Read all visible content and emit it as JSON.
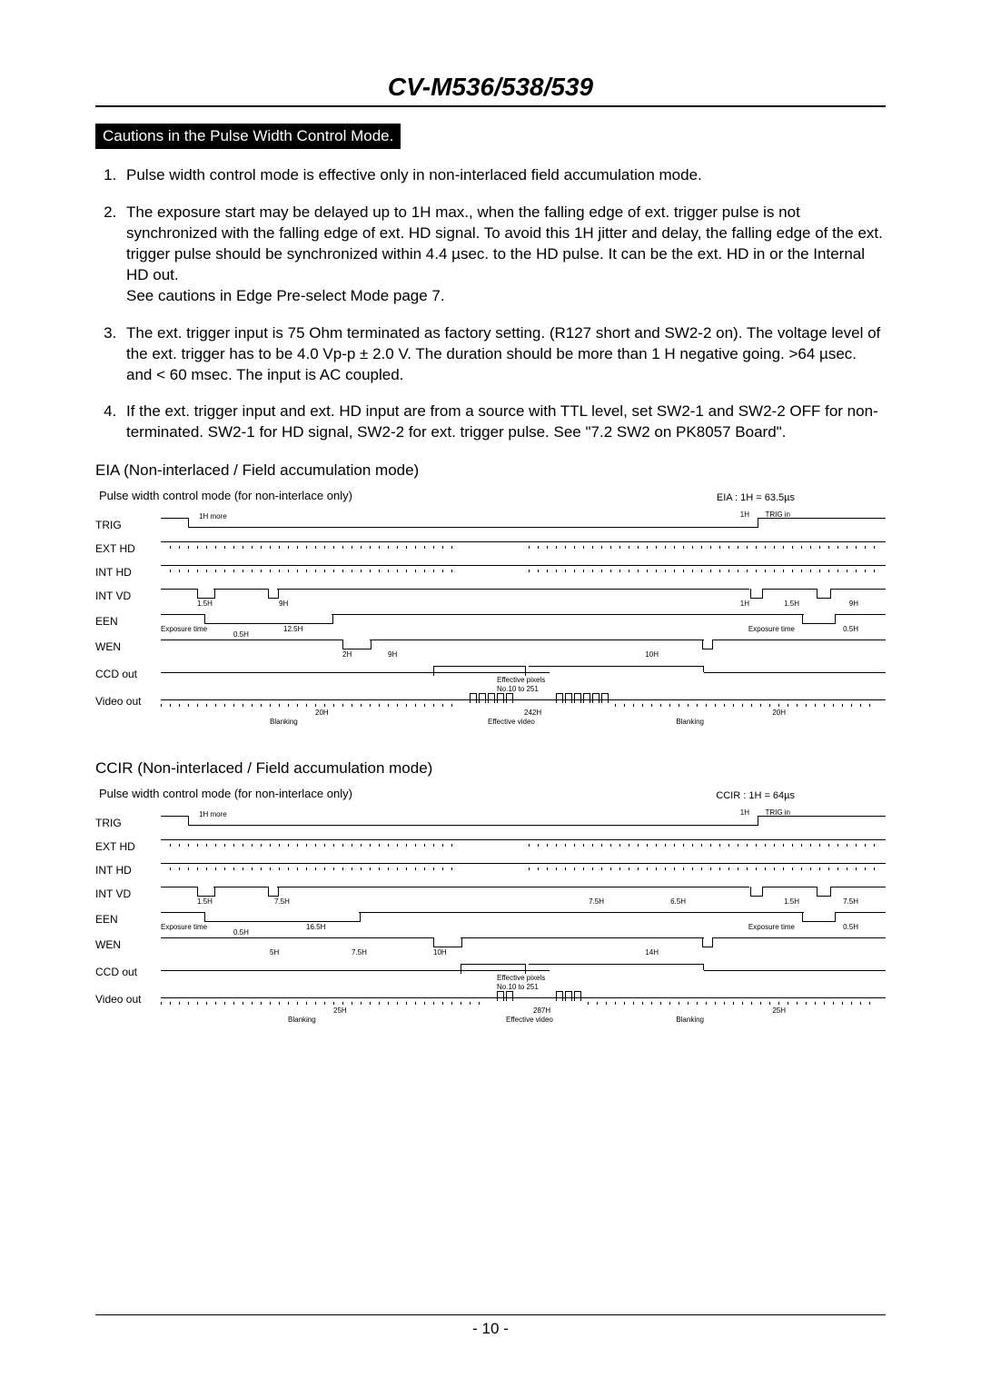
{
  "header": {
    "title": "CV-M536/538/539"
  },
  "box_caption": "Cautions in the Pulse Width Control Mode.",
  "cautions": [
    "Pulse width control mode is effective only in non-interlaced field accumulation mode.",
    "The exposure start may be delayed up to 1H max., when the falling edge of ext. trigger pulse is not synchronized with the falling edge of ext. HD signal. To avoid this 1H jitter and delay, the falling edge of the ext. trigger pulse should be synchronized within 4.4 µsec. to the HD pulse. It can be the ext. HD in or the Internal HD out.\nSee cautions in Edge Pre-select Mode page 7.",
    "The ext. trigger input is 75 Ohm terminated as factory setting. (R127 short and SW2-2 on). The voltage level of the ext. trigger has to be 4.0 Vp-p ± 2.0 V. The duration should be more than 1 H negative going. >64 µsec. and < 60 msec. The input is AC coupled.",
    "If the ext. trigger input and ext. HD input are from a source with TTL level, set SW2-1 and SW2-2 OFF for non-terminated. SW2-1 for HD signal, SW2-2 for ext. trigger pulse. See \"7.2 SW2 on PK8057 Board\"."
  ],
  "diagram1": {
    "subtitle": "EIA (Non-interlaced / Field accumulation mode)",
    "caption": "Pulse width control mode (for non-interlace only)",
    "note": "EIA : 1H = 63.5µs",
    "rows": [
      "TRIG",
      "EXT HD",
      "INT HD",
      "INT VD",
      "EEN",
      "WEN",
      "CCD out",
      "Video out"
    ],
    "ann": {
      "trig_1h_more": "1H more",
      "trig_1h": "1H",
      "trig_in": "TRIG in",
      "vd_1_5h": "1.5H",
      "vd_9h": "9H",
      "vd_1h": "1H",
      "vd_1_5h_b": "1.5H",
      "vd_9h_b": "9H",
      "een_exp": "Exposure time",
      "een_0_5h": "0.5H",
      "een_12_5h": "12.5H",
      "een_exp2": "Exposure time",
      "een_0_5h_b": "0.5H",
      "wen_2h": "2H",
      "wen_9h": "9H",
      "wen_10h": "10H",
      "ccd_eff": "Effective pixels",
      "ccd_no": "No.10 to 251",
      "vout_20h": "20H",
      "vout_242h": "242H",
      "vout_20h_b": "20H",
      "vout_blanking": "Blanking",
      "vout_eff": "Effective video",
      "vout_blanking_b": "Blanking"
    }
  },
  "diagram2": {
    "subtitle": "CCIR (Non-interlaced / Field accumulation mode)",
    "caption": "Pulse width control mode (for non-interlace only)",
    "note": "CCIR : 1H = 64µs",
    "rows": [
      "TRIG",
      "EXT HD",
      "INT HD",
      "INT VD",
      "EEN",
      "WEN",
      "CCD out",
      "Video out"
    ],
    "ann": {
      "trig_1h_more": "1H more",
      "trig_1h": "1H",
      "trig_in": "TRIG in",
      "vd_1_5h": "1.5H",
      "vd_7_5h": "7.5H",
      "vd_7_5h_b": "7.5H",
      "vd_6_5h": "6.5H",
      "vd_1_5h_c": "1.5H",
      "vd_7_5h_c": "7.5H",
      "een_exp": "Exposure time",
      "een_0_5h": "0.5H",
      "een_16_5h": "16.5H",
      "een_exp2": "Exposure time",
      "een_0_5h_b": "0.5H",
      "wen_5h": "5H",
      "wen_7_5h": "7.5H",
      "wen_10h": "10H",
      "wen_14h": "14H",
      "ccd_eff": "Effective pixels",
      "ccd_no": "No.10 to 251",
      "vout_25h": "25H",
      "vout_287h": "287H",
      "vout_25h_b": "25H",
      "vout_blanking": "Blanking",
      "vout_eff": "Effective video",
      "vout_blanking_b": "Blanking"
    }
  },
  "footer": {
    "page": "- 10 -"
  }
}
